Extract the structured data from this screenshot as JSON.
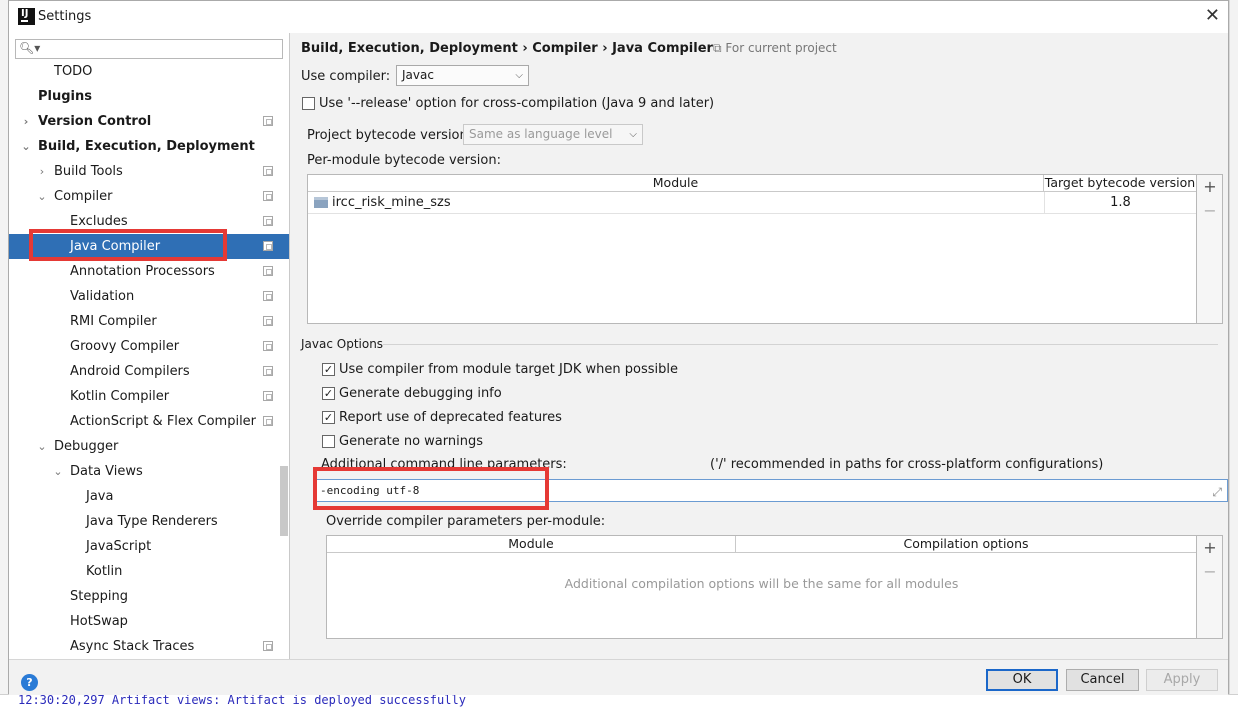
{
  "background": {
    "console_line": "12:30:20,297 Artifact views: Artifact is deployed successfully"
  },
  "window": {
    "title": "Settings",
    "app_icon": "intellij-icon",
    "close_icon": "✕"
  },
  "tree": {
    "search_placeholder": "",
    "items": [
      {
        "label": "TODO",
        "indent": 2,
        "bold": false,
        "arrow": "",
        "copy": false
      },
      {
        "label": "Plugins",
        "indent": 1,
        "bold": true,
        "arrow": "",
        "copy": false
      },
      {
        "label": "Version Control",
        "indent": 1,
        "bold": true,
        "arrow": "›",
        "copy": true
      },
      {
        "label": "Build, Execution, Deployment",
        "indent": 1,
        "bold": true,
        "arrow": "⌄",
        "copy": false
      },
      {
        "label": "Build Tools",
        "indent": 2,
        "bold": false,
        "arrow": "›",
        "copy": true
      },
      {
        "label": "Compiler",
        "indent": 2,
        "bold": false,
        "arrow": "⌄",
        "copy": true
      },
      {
        "label": "Excludes",
        "indent": 3,
        "bold": false,
        "arrow": "",
        "copy": true
      },
      {
        "label": "Java Compiler",
        "indent": 3,
        "bold": false,
        "arrow": "",
        "copy": true,
        "selected": true
      },
      {
        "label": "Annotation Processors",
        "indent": 3,
        "bold": false,
        "arrow": "",
        "copy": true
      },
      {
        "label": "Validation",
        "indent": 3,
        "bold": false,
        "arrow": "",
        "copy": true
      },
      {
        "label": "RMI Compiler",
        "indent": 3,
        "bold": false,
        "arrow": "",
        "copy": true
      },
      {
        "label": "Groovy Compiler",
        "indent": 3,
        "bold": false,
        "arrow": "",
        "copy": true
      },
      {
        "label": "Android Compilers",
        "indent": 3,
        "bold": false,
        "arrow": "",
        "copy": true
      },
      {
        "label": "Kotlin Compiler",
        "indent": 3,
        "bold": false,
        "arrow": "",
        "copy": true
      },
      {
        "label": "ActionScript & Flex Compiler",
        "indent": 3,
        "bold": false,
        "arrow": "",
        "copy": true
      },
      {
        "label": "Debugger",
        "indent": 2,
        "bold": false,
        "arrow": "⌄",
        "copy": false
      },
      {
        "label": "Data Views",
        "indent": 3,
        "bold": false,
        "arrow": "⌄",
        "copy": false
      },
      {
        "label": "Java",
        "indent": 4,
        "bold": false,
        "arrow": "",
        "copy": false
      },
      {
        "label": "Java Type Renderers",
        "indent": 4,
        "bold": false,
        "arrow": "",
        "copy": false
      },
      {
        "label": "JavaScript",
        "indent": 4,
        "bold": false,
        "arrow": "",
        "copy": false
      },
      {
        "label": "Kotlin",
        "indent": 4,
        "bold": false,
        "arrow": "",
        "copy": false
      },
      {
        "label": "Stepping",
        "indent": 3,
        "bold": false,
        "arrow": "",
        "copy": false
      },
      {
        "label": "HotSwap",
        "indent": 3,
        "bold": false,
        "arrow": "",
        "copy": false
      },
      {
        "label": "Async Stack Traces",
        "indent": 3,
        "bold": false,
        "arrow": "",
        "copy": true
      }
    ]
  },
  "content": {
    "breadcrumb": "Build, Execution, Deployment  ›  Compiler  ›  Java Compiler",
    "for_project": "For current project",
    "use_compiler_label": "Use compiler:",
    "use_compiler_value": "Javac",
    "release_option_label": "Use '--release' option for cross-compilation (Java 9 and later)",
    "release_option_checked": false,
    "bytecode_label": "Project bytecode version:",
    "bytecode_value": "Same as language level",
    "per_module_label": "Per-module bytecode version:",
    "module_table": {
      "headers": [
        "Module",
        "Target bytecode version"
      ],
      "rows": [
        {
          "module": "ircc_risk_mine_szs",
          "version": "1.8"
        }
      ]
    },
    "javac_options_title": "Javac Options",
    "options": [
      {
        "label": "Use compiler from module target JDK when possible",
        "checked": true
      },
      {
        "label": "Generate debugging info",
        "checked": true
      },
      {
        "label": "Report use of deprecated features",
        "checked": true
      },
      {
        "label": "Generate no warnings",
        "checked": false
      }
    ],
    "additional_params_label": "Additional command line parameters:",
    "additional_params_hint": "('/' recommended in paths for cross-platform configurations)",
    "additional_params_value": "-encoding utf-8",
    "override_label": "Override compiler parameters per-module:",
    "override_table": {
      "headers": [
        "Module",
        "Compilation options"
      ],
      "empty_text": "Additional compilation options will be the same for all modules"
    },
    "add_glyph": "+",
    "remove_glyph": "−"
  },
  "footer": {
    "help": "?",
    "ok": "OK",
    "cancel": "Cancel",
    "apply": "Apply"
  },
  "colors": {
    "selection": "#2f6fb5",
    "highlight_box": "#e53935",
    "focus_border": "#6b9bd2"
  }
}
